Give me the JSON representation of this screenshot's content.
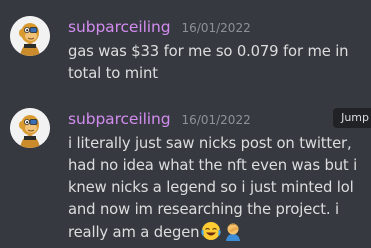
{
  "messages": [
    {
      "username": "subparceiling",
      "timestamp": "16/01/2022",
      "text": "gas was $33 for me so 0.079 for me in total to mint",
      "avatar_icon": "ape-avatar-icon"
    },
    {
      "username": "subparceiling",
      "timestamp": "16/01/2022",
      "text": "i literally just saw nicks post on twitter, had no idea what the nft even was but i knew nicks a legend so i just minted lol and now im researching the project. i really am a degen",
      "avatar_icon": "ape-avatar-icon",
      "emojis": [
        "joy-emoji-icon",
        "facepalm-emoji-icon"
      ]
    }
  ],
  "hover_toolbar": {
    "jump_label": "Jump"
  },
  "colors": {
    "background": "#36393f",
    "username": "#d28cf0",
    "timestamp": "#8e9297",
    "text": "#dcddde"
  }
}
